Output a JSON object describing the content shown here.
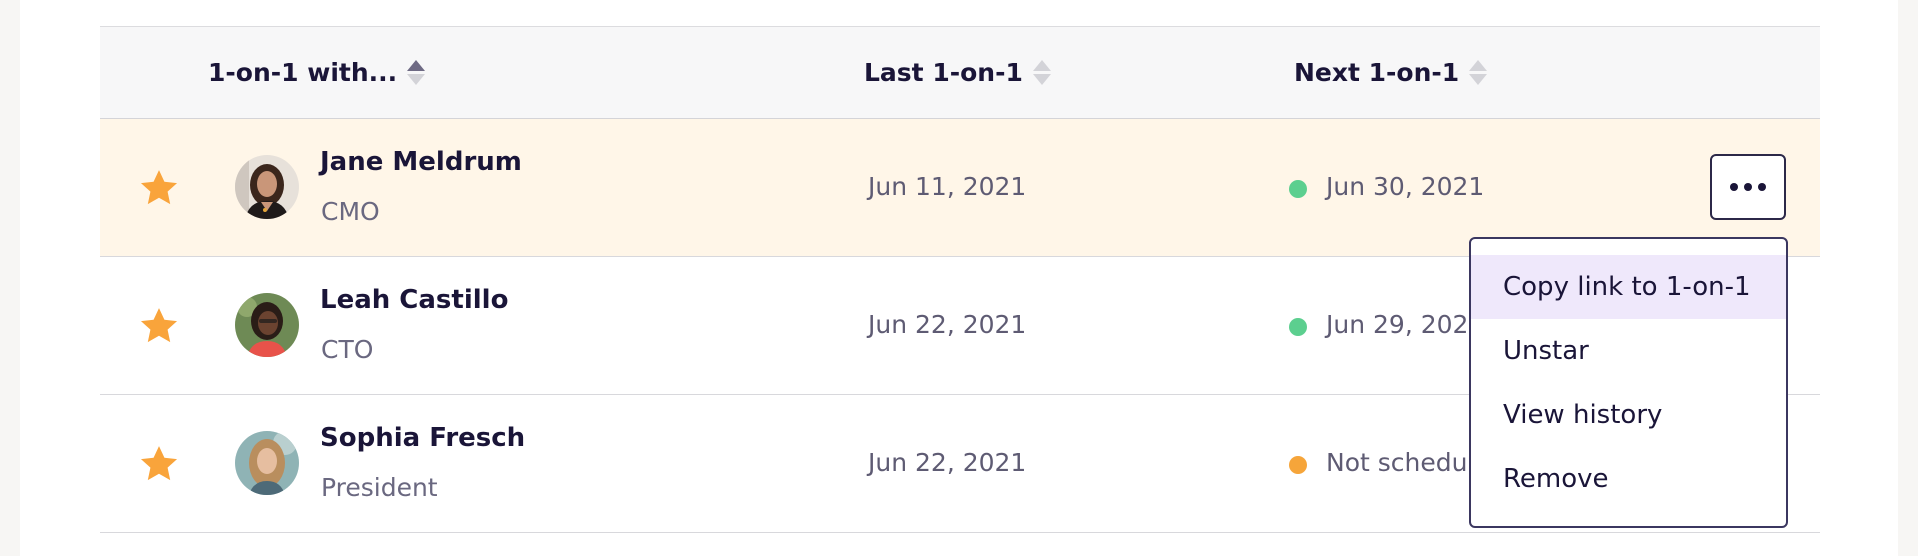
{
  "table": {
    "columns": [
      {
        "label": "1-on-1 with...",
        "sort": "asc"
      },
      {
        "label": "Last 1-on-1",
        "sort": "none"
      },
      {
        "label": "Next 1-on-1",
        "sort": "none"
      }
    ],
    "rows": [
      {
        "starred": true,
        "name": "Jane Meldrum",
        "role": "CMO",
        "last": "Jun 11, 2021",
        "next": "Jun 30, 2021",
        "status_color": "#5ccf8f",
        "highlighted": true
      },
      {
        "starred": true,
        "name": "Leah Castillo",
        "role": "CTO",
        "last": "Jun 22, 2021",
        "next": "Jun 29, 2021",
        "status_color": "#5ccf8f",
        "highlighted": false
      },
      {
        "starred": true,
        "name": "Sophia Fresch",
        "role": "President",
        "last": "Jun 22, 2021",
        "next": "Not scheduled",
        "status_color": "#f6a53a",
        "highlighted": false
      }
    ]
  },
  "menu": {
    "items": [
      "Copy link to 1-on-1",
      "Unstar",
      "View history",
      "Remove"
    ],
    "active_index": 0
  },
  "icons": {
    "star": "star-icon",
    "more": "more-horizontal-icon"
  },
  "colors": {
    "star": "#f9a43b",
    "highlight_row": "#fff6e8",
    "menu_hover": "#efe8fb"
  }
}
